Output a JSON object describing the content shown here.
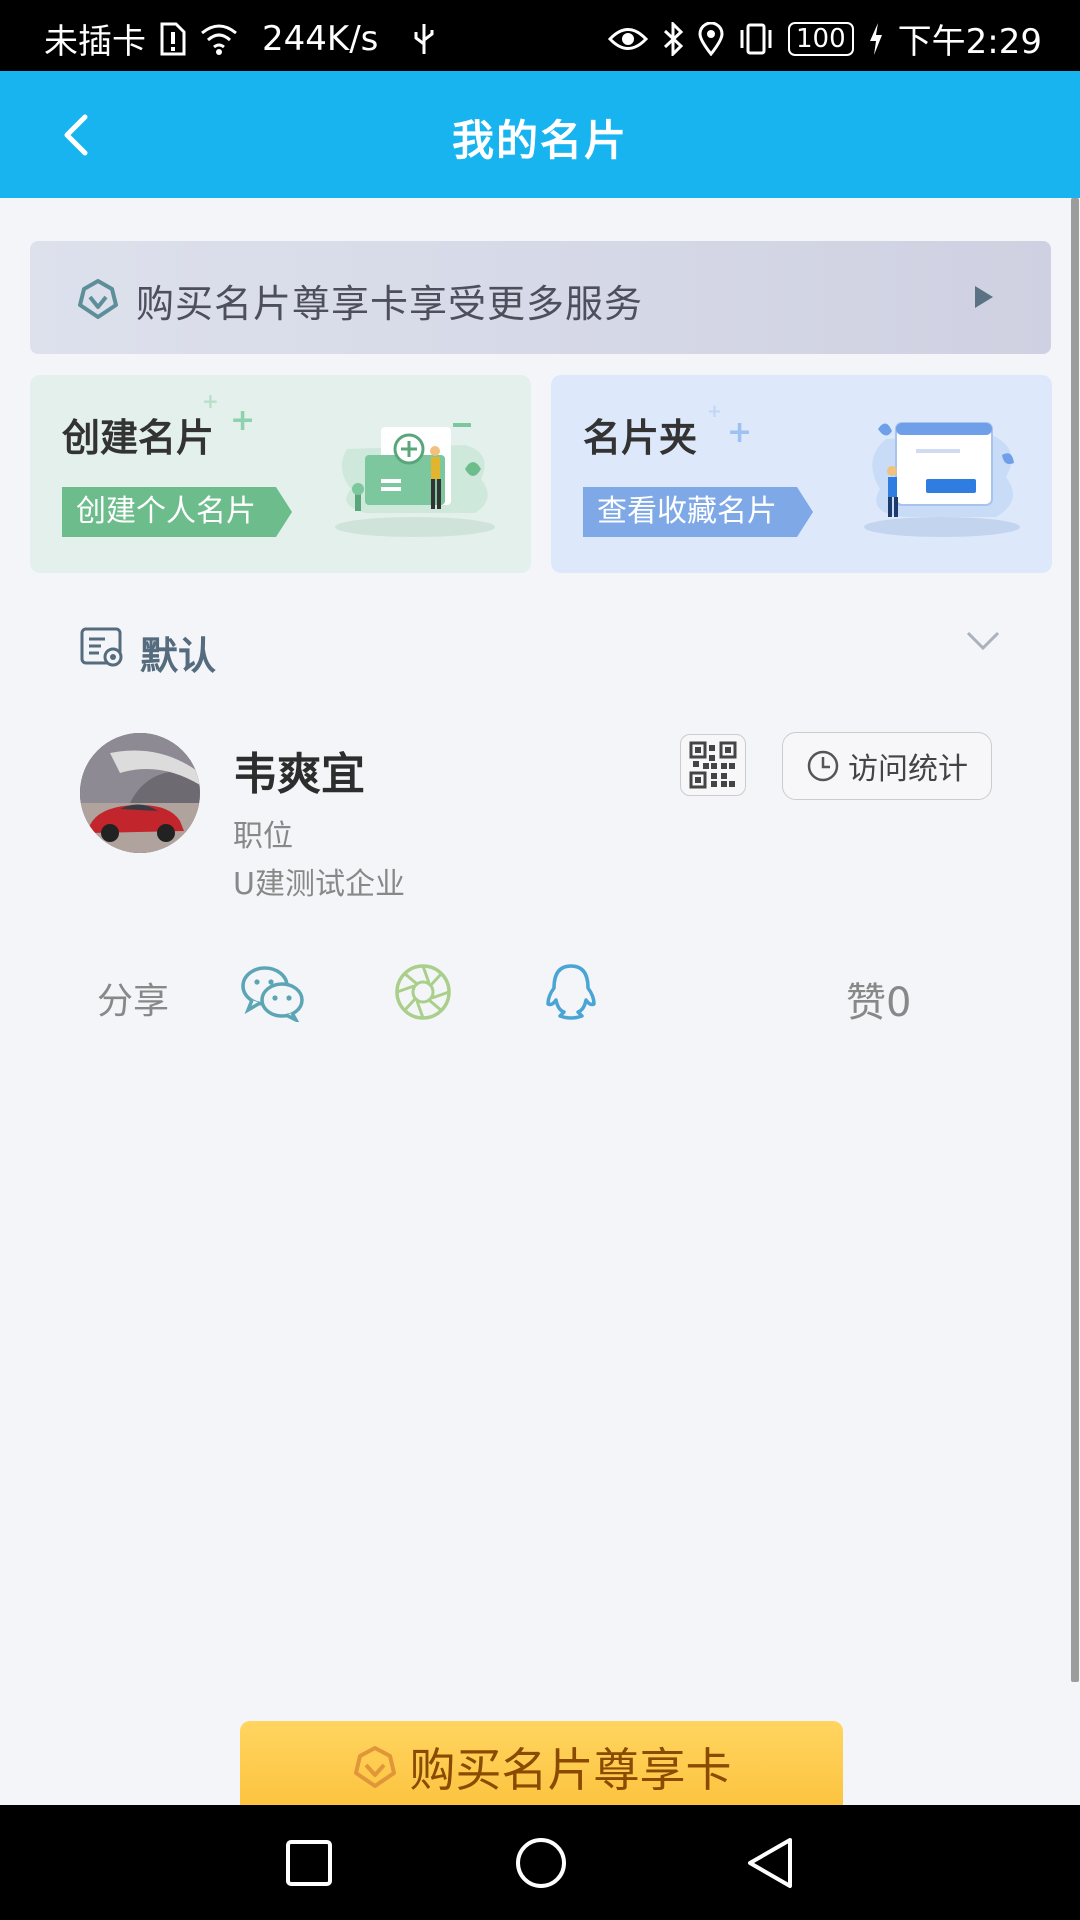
{
  "status_bar": {
    "carrier": "未插卡",
    "speed": "244K/s",
    "battery": "100",
    "time": "下午2:29"
  },
  "header": {
    "title": "我的名片"
  },
  "promo": {
    "text": "购买名片尊享卡享受更多服务"
  },
  "cards": {
    "create": {
      "title": "创建名片",
      "tag": "创建个人名片"
    },
    "folder": {
      "title": "名片夹",
      "tag": "查看收藏名片"
    }
  },
  "default_card": {
    "section_label": "默认",
    "name": "韦爽宜",
    "position": "职位",
    "company": "U建测试企业",
    "stats_label": "访问统计",
    "share_label": "分享",
    "likes": "赞0"
  },
  "buy_button": {
    "label": "购买名片尊享卡"
  },
  "colors": {
    "header": "#17b4ef",
    "create_tag": "#6dbd8c",
    "folder_tag": "#7fa9e6",
    "buy_button": "#fcc23d"
  }
}
